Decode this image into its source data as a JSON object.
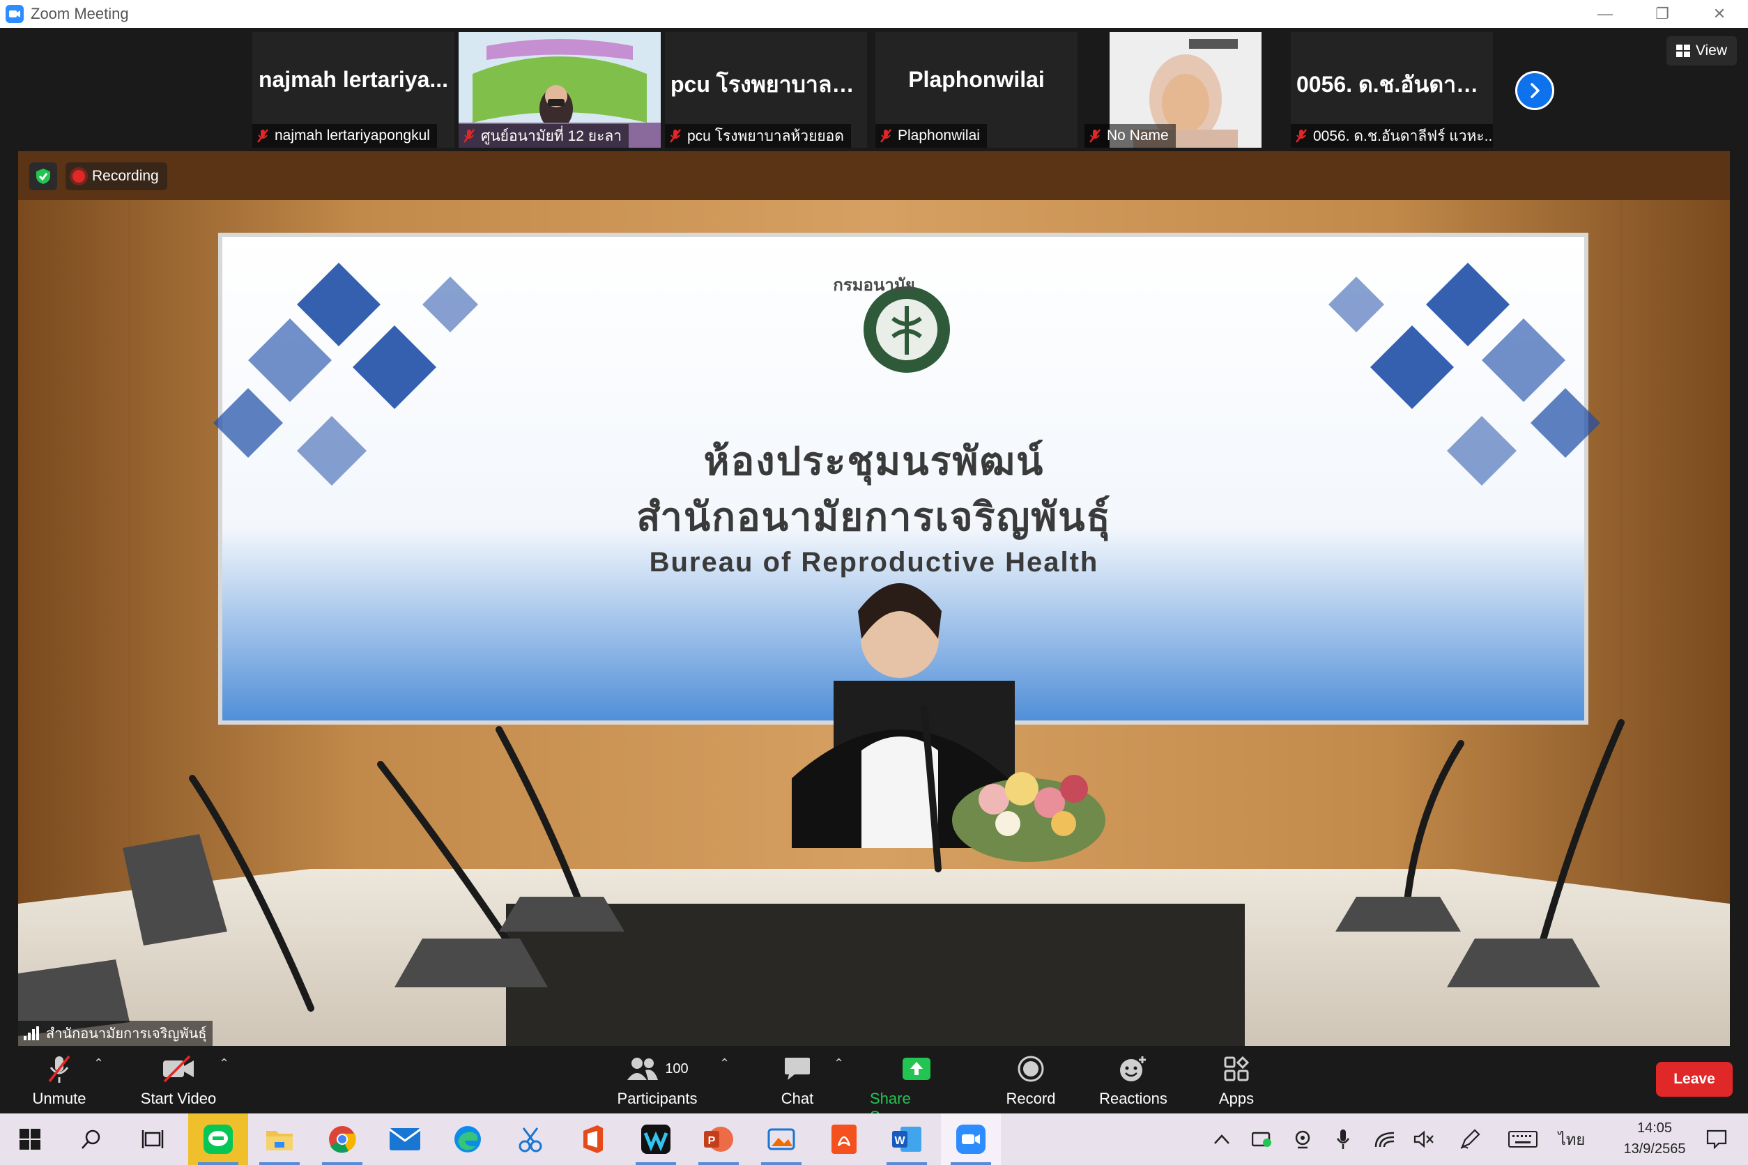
{
  "window": {
    "title": "Zoom Meeting",
    "controls": [
      "minimize",
      "restore",
      "close"
    ]
  },
  "header": {
    "view_label": "View"
  },
  "participants_strip": [
    {
      "display_name": "najmah lertariya...",
      "label": "najmah lertariyapongkul",
      "muted": true,
      "has_video": false
    },
    {
      "display_name": "",
      "label": "ศูนย์อนามัยที่ 12 ยะลา",
      "muted": true,
      "has_video": true
    },
    {
      "display_name": "pcu โรงพยาบาลห้...",
      "label": "pcu โรงพยาบาลห้วยยอด",
      "muted": true,
      "has_video": false
    },
    {
      "display_name": "Plaphonwilai",
      "label": "Plaphonwilai",
      "muted": true,
      "has_video": false
    },
    {
      "display_name": "",
      "label": "No Name",
      "muted": true,
      "has_video": true
    },
    {
      "display_name": "0056. ด.ช.อันดาลี...",
      "label": "0056. ด.ช.อันดาลีฟร์ แวหะ...",
      "muted": true,
      "has_video": false
    }
  ],
  "main_video": {
    "recording_label": "Recording",
    "speaker_name": "สำนักอนามัยการเจริญพันธุ์",
    "banner": {
      "logo_text": "กรมอนามัย",
      "line1": "ห้องประชุมนรพัฒน์",
      "line2": "สำนักอนามัยการเจริญพันธุ์",
      "line3": "Bureau of Reproductive Health"
    }
  },
  "toolbar": {
    "unmute_label": "Unmute",
    "start_video_label": "Start Video",
    "participants_label": "Participants",
    "participants_count": "100",
    "chat_label": "Chat",
    "share_screen_label": "Share Screen",
    "record_label": "Record",
    "reactions_label": "Reactions",
    "apps_label": "Apps",
    "leave_label": "Leave"
  },
  "taskbar": {
    "apps": [
      "start-icon",
      "search-icon",
      "task-view-icon",
      "line-icon",
      "file-explorer-icon",
      "chrome-icon",
      "mail-icon",
      "edge-icon",
      "snip-icon",
      "office-icon",
      "webex-icon",
      "powerpoint-icon",
      "photos-icon",
      "pdf-icon",
      "word-icon",
      "zoom-icon"
    ],
    "language": "ไทย",
    "time": "14:05",
    "date": "13/9/2565"
  },
  "colors": {
    "accent": "#0e72ed",
    "leave": "#e02828",
    "share_green": "#23c552",
    "recording": "#e02828"
  }
}
